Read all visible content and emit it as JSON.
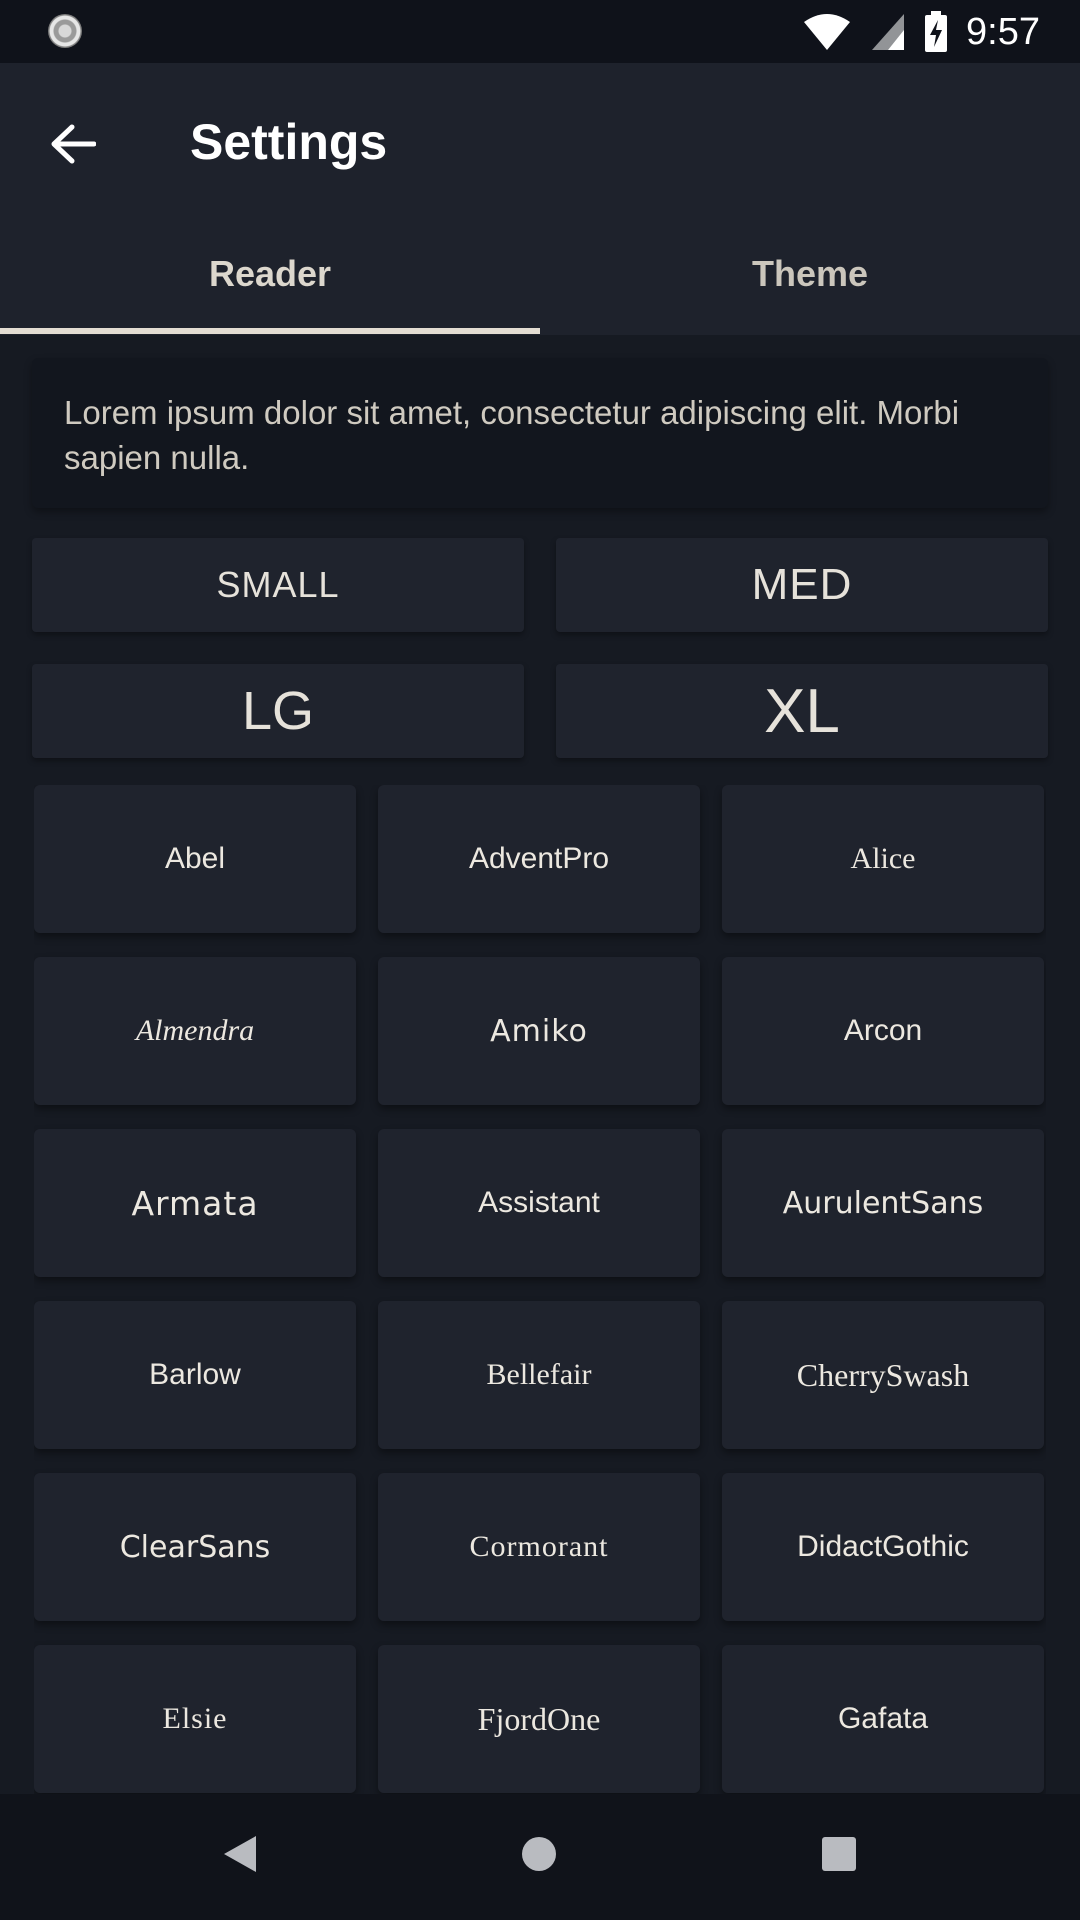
{
  "status_bar": {
    "time": "9:57"
  },
  "app_bar": {
    "title": "Settings"
  },
  "tabs": [
    {
      "label": "Reader",
      "selected": true
    },
    {
      "label": "Theme",
      "selected": false
    }
  ],
  "preview": {
    "text": "Lorem ipsum dolor sit amet, consectetur adipiscing elit. Morbi sapien nulla."
  },
  "sizes": {
    "small": "SMALL",
    "med": "MED",
    "lg": "LG",
    "xl": "XL"
  },
  "fonts": [
    "Abel",
    "AdventPro",
    "Alice",
    "Almendra",
    "Amiko",
    "Arcon",
    "Armata",
    "Assistant",
    "AurulentSans",
    "Barlow",
    "Bellefair",
    "CherrySwash",
    "ClearSans",
    "Cormorant",
    "DidactGothic",
    "Elsie",
    "FjordOne",
    "Gafata"
  ],
  "colors": {
    "background": "#161a22",
    "surface": "#1f232d",
    "app_bar": "#1e222c",
    "text": "#e6e4e0"
  }
}
